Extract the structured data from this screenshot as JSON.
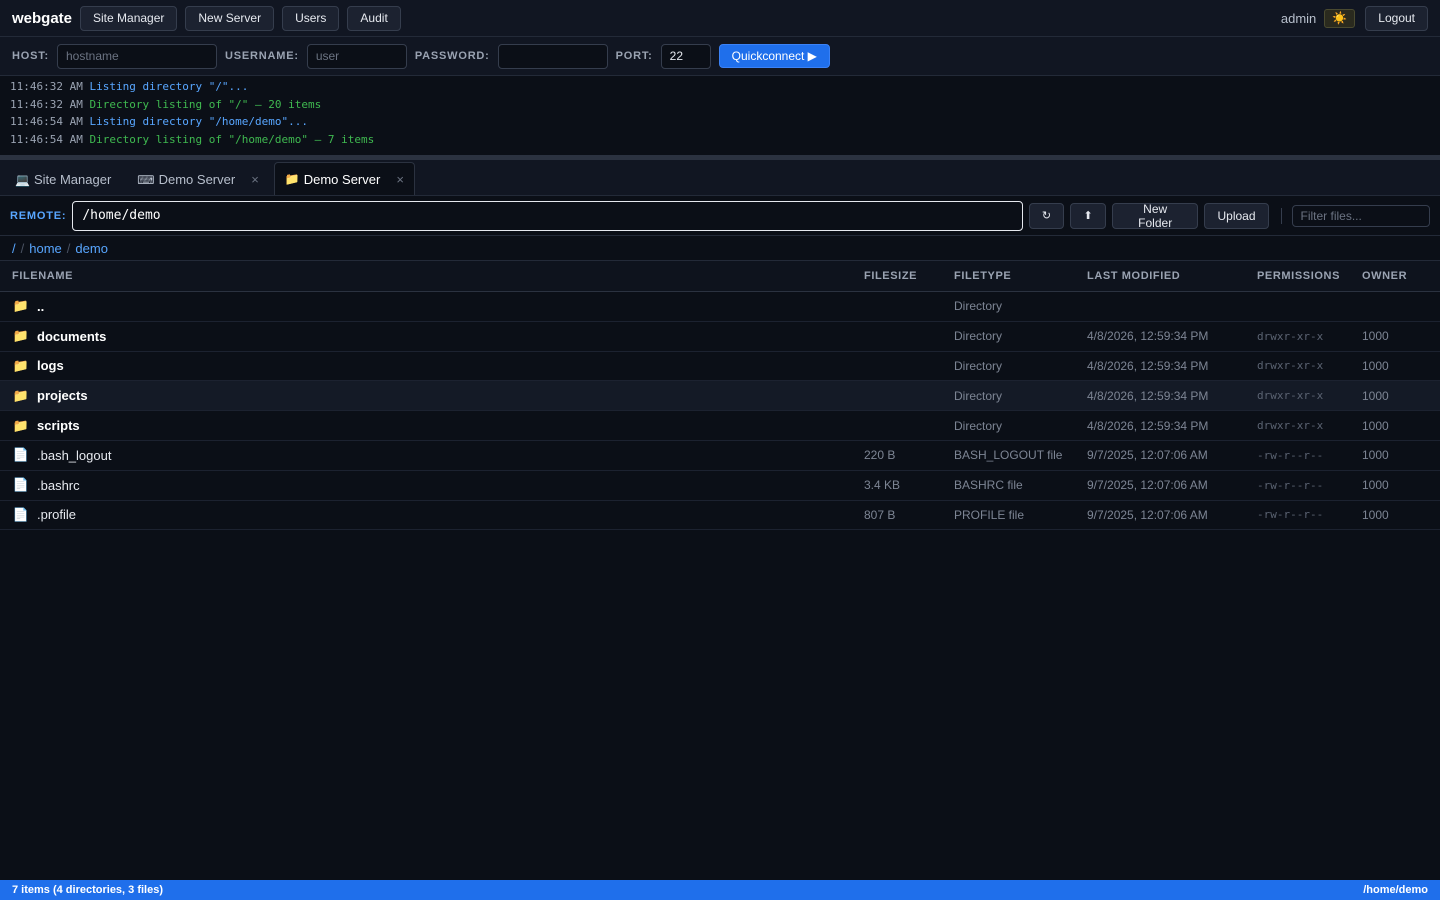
{
  "app": {
    "brand": "webgate"
  },
  "nav": {
    "buttons": [
      {
        "label": "Site Manager"
      },
      {
        "label": "New Server"
      },
      {
        "label": "Users"
      },
      {
        "label": "Audit"
      }
    ],
    "user": "admin",
    "theme_icon": "sun-icon",
    "theme_glyph": "☀️",
    "logout_label": "Logout"
  },
  "quickconnect": {
    "host_label": "HOST:",
    "host_placeholder": "hostname",
    "username_label": "USERNAME:",
    "username_placeholder": "user",
    "password_label": "PASSWORD:",
    "password_value": "",
    "port_label": "PORT:",
    "port_value": "22",
    "button_label": "Quickconnect ▶"
  },
  "log": {
    "lines": [
      {
        "time": "11:46:32 AM",
        "message": "Listing directory \"/\"...",
        "level": "info"
      },
      {
        "time": "11:46:32 AM",
        "message": "Directory listing of \"/\" — 20 items",
        "level": "ok"
      },
      {
        "time": "11:46:54 AM",
        "message": "Listing directory \"/home/demo\"...",
        "level": "info"
      },
      {
        "time": "11:46:54 AM",
        "message": "Directory listing of \"/home/demo\" — 7 items",
        "level": "ok"
      }
    ]
  },
  "tabs": [
    {
      "icon": "laptop-icon",
      "glyph": "💻",
      "label": "Site Manager",
      "closable": false,
      "active": false
    },
    {
      "icon": "terminal-icon",
      "glyph": "⌨",
      "label": "Demo Server",
      "closable": true,
      "active": false
    },
    {
      "icon": "folder-icon",
      "glyph": "📁",
      "label": "Demo Server",
      "closable": true,
      "active": true
    }
  ],
  "tab_close_glyph": "×",
  "remote": {
    "label": "REMOTE:",
    "path": "/home/demo",
    "refresh_glyph": "↻",
    "up_glyph": "⬆",
    "new_folder_label": "New Folder",
    "upload_label": "Upload",
    "filter_placeholder": "Filter files..."
  },
  "breadcrumb": {
    "root": "/",
    "parts": [
      "home",
      "demo"
    ]
  },
  "table": {
    "headers": {
      "filename": "FILENAME",
      "filesize": "FILESIZE",
      "filetype": "FILETYPE",
      "modified": "LAST MODIFIED",
      "permissions": "PERMISSIONS",
      "owner": "OWNER"
    },
    "rows": [
      {
        "kind": "dir",
        "name": "..",
        "size": "",
        "type": "Directory",
        "modified": "",
        "perms": "",
        "owner": ""
      },
      {
        "kind": "dir",
        "name": "documents",
        "size": "",
        "type": "Directory",
        "modified": "4/8/2026, 12:59:34 PM",
        "perms": "drwxr-xr-x",
        "owner": "1000"
      },
      {
        "kind": "dir",
        "name": "logs",
        "size": "",
        "type": "Directory",
        "modified": "4/8/2026, 12:59:34 PM",
        "perms": "drwxr-xr-x",
        "owner": "1000"
      },
      {
        "kind": "dir",
        "name": "projects",
        "size": "",
        "type": "Directory",
        "modified": "4/8/2026, 12:59:34 PM",
        "perms": "drwxr-xr-x",
        "owner": "1000"
      },
      {
        "kind": "dir",
        "name": "scripts",
        "size": "",
        "type": "Directory",
        "modified": "4/8/2026, 12:59:34 PM",
        "perms": "drwxr-xr-x",
        "owner": "1000"
      },
      {
        "kind": "file",
        "name": ".bash_logout",
        "size": "220 B",
        "type": "BASH_LOGOUT file",
        "modified": "9/7/2025, 12:07:06 AM",
        "perms": "-rw-r--r--",
        "owner": "1000"
      },
      {
        "kind": "file",
        "name": ".bashrc",
        "size": "3.4 KB",
        "type": "BASHRC file",
        "modified": "9/7/2025, 12:07:06 AM",
        "perms": "-rw-r--r--",
        "owner": "1000"
      },
      {
        "kind": "file",
        "name": ".profile",
        "size": "807 B",
        "type": "PROFILE file",
        "modified": "9/7/2025, 12:07:06 AM",
        "perms": "-rw-r--r--",
        "owner": "1000"
      }
    ],
    "hover_row": 3
  },
  "status": {
    "summary": "7 items (4 directories, 3 files)",
    "path": "/home/demo"
  }
}
